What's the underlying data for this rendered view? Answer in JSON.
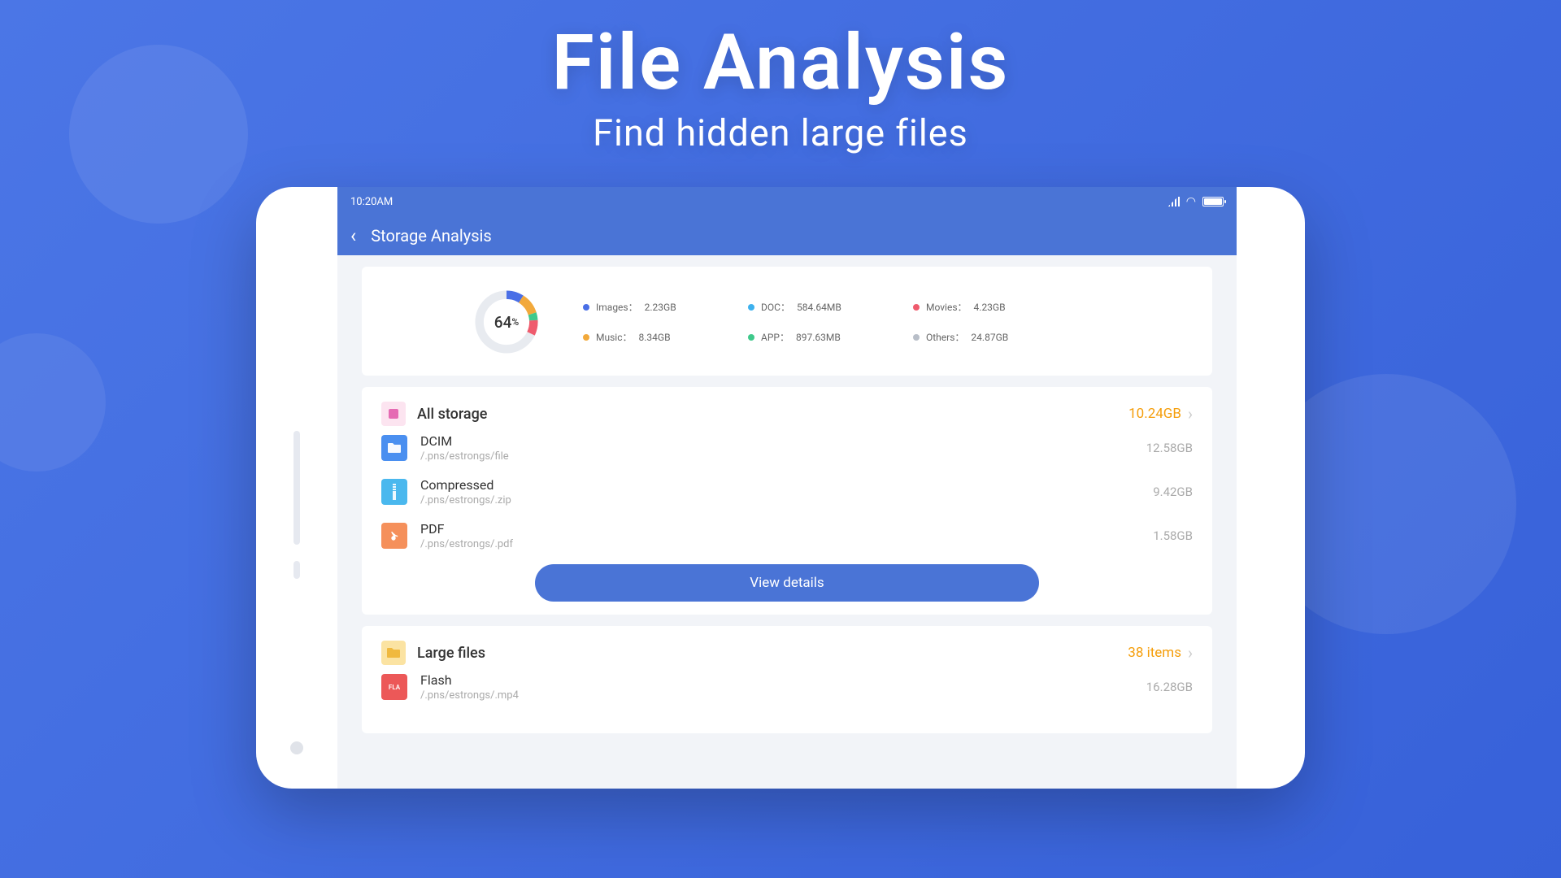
{
  "hero": {
    "title": "File Analysis",
    "subtitle": "Find hidden large files"
  },
  "status": {
    "time": "10:20AM"
  },
  "header": {
    "title": "Storage Analysis"
  },
  "summary": {
    "percent": "64",
    "percent_unit": "%",
    "cats": [
      {
        "label": "Images：",
        "value": "2.23GB",
        "color": "#4a6fe6"
      },
      {
        "label": "DOC：",
        "value": "584.64MB",
        "color": "#3db1ee"
      },
      {
        "label": "Movies：",
        "value": "4.23GB",
        "color": "#ef5b6d"
      },
      {
        "label": "Music：",
        "value": "8.34GB",
        "color": "#f2a93b"
      },
      {
        "label": "APP：",
        "value": "897.63MB",
        "color": "#3fc98b"
      },
      {
        "label": "Others：",
        "value": "24.87GB",
        "color": "#b8bec8"
      }
    ]
  },
  "all_storage": {
    "title": "All storage",
    "total": "10.24GB",
    "items": [
      {
        "name": "DCIM",
        "path": "/.pns/estrongs/file",
        "size": "12.58GB",
        "cls": "fi-blue"
      },
      {
        "name": "Compressed",
        "path": "/.pns/estrongs/.zip",
        "size": "9.42GB",
        "cls": "fi-cyan"
      },
      {
        "name": "PDF",
        "path": "/.pns/estrongs/.pdf",
        "size": "1.58GB",
        "cls": "fi-orange"
      }
    ],
    "button": "View details"
  },
  "large_files": {
    "title": "Large files",
    "count": "38 items",
    "items": [
      {
        "name": "Flash",
        "path": "/.pns/estrongs/.mp4",
        "size": "16.28GB",
        "cls": "fi-red"
      }
    ]
  }
}
